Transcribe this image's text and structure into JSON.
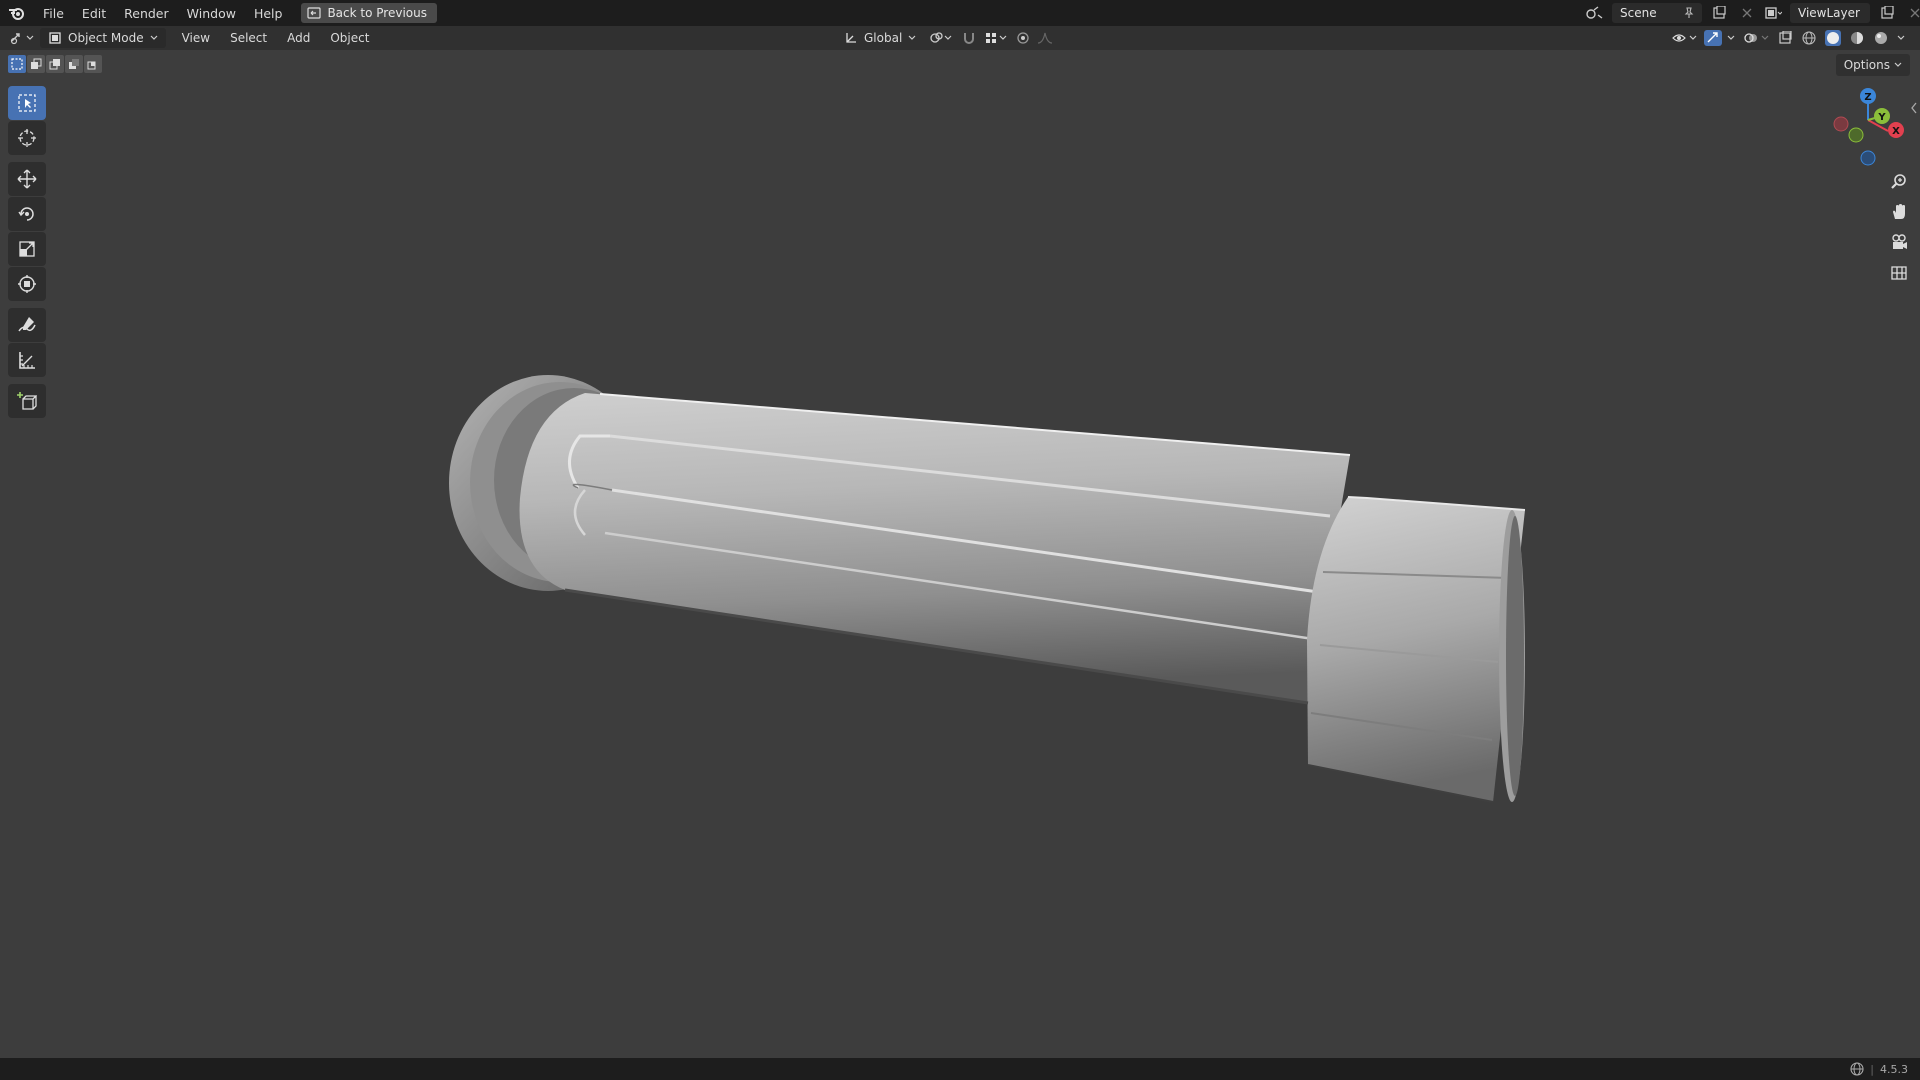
{
  "topbar": {
    "menus": [
      "File",
      "Edit",
      "Render",
      "Window",
      "Help"
    ],
    "back_label": "Back to Previous",
    "scene_name": "Scene",
    "view_layer": "ViewLayer"
  },
  "header": {
    "mode": "Object Mode",
    "menus": [
      "View",
      "Select",
      "Add",
      "Object"
    ],
    "transform_orientation": "Global"
  },
  "viewport": {
    "options_label": "Options",
    "gizmo_axes": {
      "x": "X",
      "y": "Y",
      "z": "Z"
    }
  },
  "statusbar": {
    "version": "4.5.3"
  },
  "colors": {
    "accent": "#4772b3",
    "axis_x": "#e2404f",
    "axis_y": "#8bbe3a",
    "axis_z": "#3b86d9",
    "background": "#3d3d3d"
  }
}
